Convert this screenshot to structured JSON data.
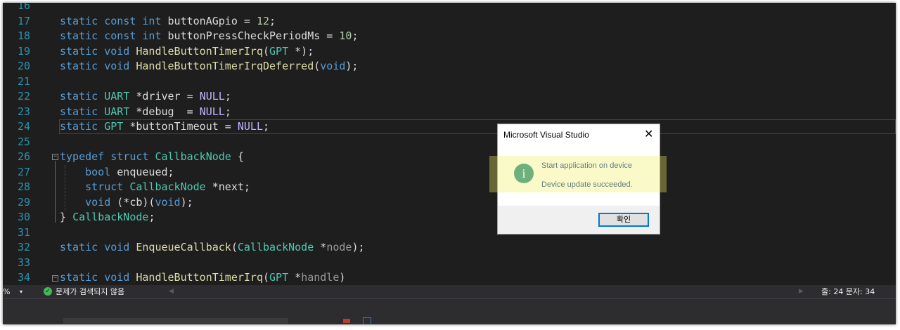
{
  "editor": {
    "lines": [
      {
        "num": "16",
        "tokens": []
      },
      {
        "num": "17",
        "tokens": [
          {
            "t": "static",
            "c": "kw"
          },
          {
            "t": " "
          },
          {
            "t": "const",
            "c": "kw"
          },
          {
            "t": " "
          },
          {
            "t": "int",
            "c": "kw"
          },
          {
            "t": " buttonAGpio = "
          },
          {
            "t": "12",
            "c": "num"
          },
          {
            "t": ";"
          }
        ]
      },
      {
        "num": "18",
        "tokens": [
          {
            "t": "static",
            "c": "kw"
          },
          {
            "t": " "
          },
          {
            "t": "const",
            "c": "kw"
          },
          {
            "t": " "
          },
          {
            "t": "int",
            "c": "kw"
          },
          {
            "t": " buttonPressCheckPeriodMs = "
          },
          {
            "t": "10",
            "c": "num"
          },
          {
            "t": ";"
          }
        ]
      },
      {
        "num": "19",
        "tokens": [
          {
            "t": "static",
            "c": "kw"
          },
          {
            "t": " "
          },
          {
            "t": "void",
            "c": "kw"
          },
          {
            "t": " "
          },
          {
            "t": "HandleButtonTimerIrq",
            "c": "fn"
          },
          {
            "t": "("
          },
          {
            "t": "GPT",
            "c": "ty"
          },
          {
            "t": " *);"
          }
        ]
      },
      {
        "num": "20",
        "tokens": [
          {
            "t": "static",
            "c": "kw"
          },
          {
            "t": " "
          },
          {
            "t": "void",
            "c": "kw"
          },
          {
            "t": " "
          },
          {
            "t": "HandleButtonTimerIrqDeferred",
            "c": "fn"
          },
          {
            "t": "("
          },
          {
            "t": "void",
            "c": "kw"
          },
          {
            "t": ");"
          }
        ]
      },
      {
        "num": "21",
        "tokens": []
      },
      {
        "num": "22",
        "tokens": [
          {
            "t": "static",
            "c": "kw"
          },
          {
            "t": " "
          },
          {
            "t": "UART",
            "c": "ty"
          },
          {
            "t": " *driver = "
          },
          {
            "t": "NULL",
            "c": "mac"
          },
          {
            "t": ";"
          }
        ]
      },
      {
        "num": "23",
        "tokens": [
          {
            "t": "static",
            "c": "kw"
          },
          {
            "t": " "
          },
          {
            "t": "UART",
            "c": "ty"
          },
          {
            "t": " *debug  = "
          },
          {
            "t": "NULL",
            "c": "mac"
          },
          {
            "t": ";"
          }
        ]
      },
      {
        "num": "24",
        "tokens": [
          {
            "t": "static",
            "c": "kw"
          },
          {
            "t": " "
          },
          {
            "t": "GPT",
            "c": "ty"
          },
          {
            "t": " *buttonTimeout = "
          },
          {
            "t": "NULL",
            "c": "mac"
          },
          {
            "t": ";"
          }
        ]
      },
      {
        "num": "25",
        "tokens": []
      },
      {
        "num": "26",
        "tokens": [
          {
            "t": "typedef",
            "c": "kw"
          },
          {
            "t": " "
          },
          {
            "t": "struct",
            "c": "kw"
          },
          {
            "t": " "
          },
          {
            "t": "CallbackNode",
            "c": "ty"
          },
          {
            "t": " {"
          }
        ]
      },
      {
        "num": "27",
        "tokens": [
          {
            "t": "    "
          },
          {
            "t": "bool",
            "c": "kw"
          },
          {
            "t": " enqueued;"
          }
        ]
      },
      {
        "num": "28",
        "tokens": [
          {
            "t": "    "
          },
          {
            "t": "struct",
            "c": "kw"
          },
          {
            "t": " "
          },
          {
            "t": "CallbackNode",
            "c": "ty"
          },
          {
            "t": " *next;"
          }
        ]
      },
      {
        "num": "29",
        "tokens": [
          {
            "t": "    "
          },
          {
            "t": "void",
            "c": "kw"
          },
          {
            "t": " (*cb)("
          },
          {
            "t": "void",
            "c": "kw"
          },
          {
            "t": ");"
          }
        ]
      },
      {
        "num": "30",
        "tokens": [
          {
            "t": "} "
          },
          {
            "t": "CallbackNode",
            "c": "ty"
          },
          {
            "t": ";"
          }
        ]
      },
      {
        "num": "31",
        "tokens": []
      },
      {
        "num": "32",
        "tokens": [
          {
            "t": "static",
            "c": "kw"
          },
          {
            "t": " "
          },
          {
            "t": "void",
            "c": "kw"
          },
          {
            "t": " "
          },
          {
            "t": "EnqueueCallback",
            "c": "fn"
          },
          {
            "t": "("
          },
          {
            "t": "CallbackNode",
            "c": "ty"
          },
          {
            "t": " *"
          },
          {
            "t": "node",
            "c": "prm"
          },
          {
            "t": ");"
          }
        ]
      },
      {
        "num": "33",
        "tokens": []
      },
      {
        "num": "34",
        "tokens": [
          {
            "t": "static",
            "c": "kw"
          },
          {
            "t": " "
          },
          {
            "t": "void",
            "c": "kw"
          },
          {
            "t": " "
          },
          {
            "t": "HandleButtonTimerIrq",
            "c": "fn"
          },
          {
            "t": "("
          },
          {
            "t": "GPT",
            "c": "ty"
          },
          {
            "t": " *"
          },
          {
            "t": "handle",
            "c": "prm"
          },
          {
            "t": ")"
          }
        ]
      }
    ]
  },
  "status_bar": {
    "zoom": "%",
    "zoom_arrow": "▾",
    "issues_text": "문제가 검색되지 않음",
    "issues_icon": "check-circle-icon",
    "position": "줄: 24   문자: 34"
  },
  "dialog": {
    "title": "Microsoft Visual Studio",
    "close_glyph": "✕",
    "icon": "info-icon",
    "icon_glyph": "i",
    "message_line1": "Start application on device",
    "message_line2": "Device update succeeded.",
    "ok_label": "확인"
  },
  "colors": {
    "editor_bg": "#1e1e1e",
    "keyword": "#569cd6",
    "type": "#4ec9b0",
    "function": "#dcdcaa",
    "number": "#b5cea8",
    "macro": "#beb7ff",
    "line_number": "#2b91af",
    "highlight": "#f0f064"
  }
}
